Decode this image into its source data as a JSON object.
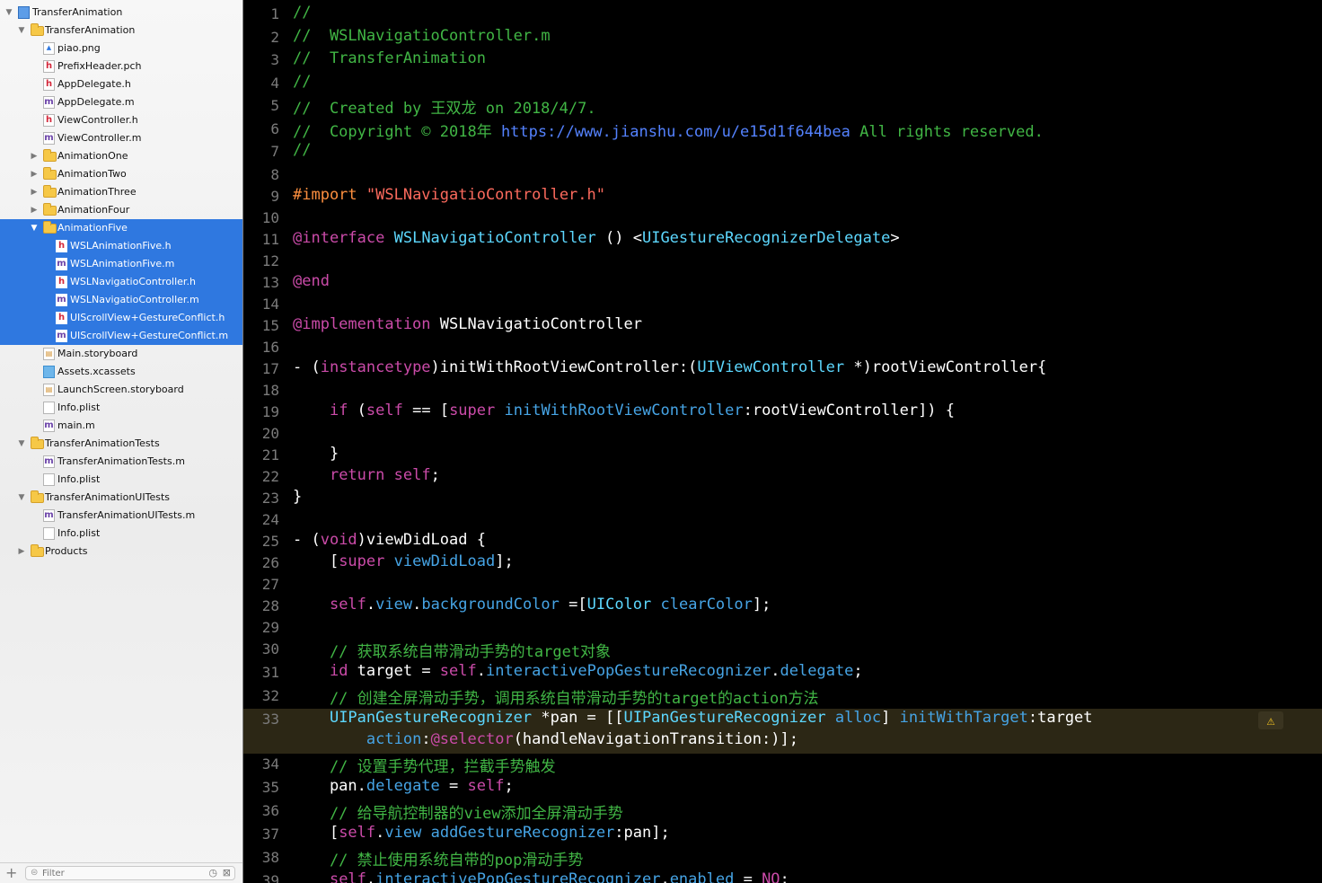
{
  "navigator": {
    "items": [
      {
        "label": "TransferAnimation",
        "icon": "project-icon",
        "depth": 0,
        "expand": "expanded",
        "selected": false
      },
      {
        "label": "TransferAnimation",
        "icon": "folder-icon",
        "depth": 1,
        "expand": "expanded",
        "selected": false
      },
      {
        "label": "piao.png",
        "icon": "image-file-icon",
        "depth": 2,
        "expand": "none",
        "selected": false
      },
      {
        "label": "PrefixHeader.pch",
        "icon": "header-file-icon",
        "depth": 2,
        "expand": "none",
        "selected": false
      },
      {
        "label": "AppDelegate.h",
        "icon": "header-file-icon",
        "depth": 2,
        "expand": "none",
        "selected": false
      },
      {
        "label": "AppDelegate.m",
        "icon": "objc-file-icon",
        "depth": 2,
        "expand": "none",
        "selected": false
      },
      {
        "label": "ViewController.h",
        "icon": "header-file-icon",
        "depth": 2,
        "expand": "none",
        "selected": false
      },
      {
        "label": "ViewController.m",
        "icon": "objc-file-icon",
        "depth": 2,
        "expand": "none",
        "selected": false
      },
      {
        "label": "AnimationOne",
        "icon": "folder-icon",
        "depth": 2,
        "expand": "collapsed",
        "selected": false
      },
      {
        "label": "AnimationTwo",
        "icon": "folder-icon",
        "depth": 2,
        "expand": "collapsed",
        "selected": false
      },
      {
        "label": "AnimationThree",
        "icon": "folder-icon",
        "depth": 2,
        "expand": "collapsed",
        "selected": false
      },
      {
        "label": "AnimationFour",
        "icon": "folder-icon",
        "depth": 2,
        "expand": "collapsed",
        "selected": false
      },
      {
        "label": "AnimationFive",
        "icon": "folder-icon",
        "depth": 2,
        "expand": "expanded",
        "selected": true
      },
      {
        "label": "WSLAnimationFive.h",
        "icon": "header-file-icon",
        "depth": 3,
        "expand": "none",
        "selected": true
      },
      {
        "label": "WSLAnimationFive.m",
        "icon": "objc-file-icon",
        "depth": 3,
        "expand": "none",
        "selected": true
      },
      {
        "label": "WSLNavigatioController.h",
        "icon": "header-file-icon",
        "depth": 3,
        "expand": "none",
        "selected": true
      },
      {
        "label": "WSLNavigatioController.m",
        "icon": "objc-file-icon",
        "depth": 3,
        "expand": "none",
        "selected": true
      },
      {
        "label": "UIScrollView+GestureConflict.h",
        "icon": "header-file-icon",
        "depth": 3,
        "expand": "none",
        "selected": true
      },
      {
        "label": "UIScrollView+GestureConflict.m",
        "icon": "objc-file-icon",
        "depth": 3,
        "expand": "none",
        "selected": true
      },
      {
        "label": "Main.storyboard",
        "icon": "storyboard-file-icon",
        "depth": 2,
        "expand": "none",
        "selected": false
      },
      {
        "label": "Assets.xcassets",
        "icon": "asset-catalog-icon",
        "depth": 2,
        "expand": "none",
        "selected": false
      },
      {
        "label": "LaunchScreen.storyboard",
        "icon": "storyboard-file-icon",
        "depth": 2,
        "expand": "none",
        "selected": false
      },
      {
        "label": "Info.plist",
        "icon": "plist-file-icon",
        "depth": 2,
        "expand": "none",
        "selected": false
      },
      {
        "label": "main.m",
        "icon": "objc-file-icon",
        "depth": 2,
        "expand": "none",
        "selected": false
      },
      {
        "label": "TransferAnimationTests",
        "icon": "folder-icon",
        "depth": 1,
        "expand": "expanded",
        "selected": false
      },
      {
        "label": "TransferAnimationTests.m",
        "icon": "objc-file-icon",
        "depth": 2,
        "expand": "none",
        "selected": false
      },
      {
        "label": "Info.plist",
        "icon": "plist-file-icon",
        "depth": 2,
        "expand": "none",
        "selected": false
      },
      {
        "label": "TransferAnimationUITests",
        "icon": "folder-icon",
        "depth": 1,
        "expand": "expanded",
        "selected": false
      },
      {
        "label": "TransferAnimationUITests.m",
        "icon": "objc-file-icon",
        "depth": 2,
        "expand": "none",
        "selected": false
      },
      {
        "label": "Info.plist",
        "icon": "plist-file-icon",
        "depth": 2,
        "expand": "none",
        "selected": false
      },
      {
        "label": "Products",
        "icon": "folder-icon",
        "depth": 1,
        "expand": "collapsed",
        "selected": false
      }
    ],
    "filter_placeholder": "Filter",
    "add_symbol": "+",
    "colors": {
      "selection": "#2f78e0",
      "background": "#f5f5f5"
    }
  },
  "editor": {
    "colors": {
      "background": "#000000",
      "comment": "#41b645",
      "keyword": "#cb4ba9",
      "string": "#fc6a5d",
      "preprocessor": "#fd8f3f",
      "type": "#5dd8ff",
      "method": "#46a4e5",
      "url": "#5482ff",
      "highlight_line": "#2c2715"
    },
    "warning_icon": "warning-icon",
    "lines": [
      {
        "n": "1",
        "tokens": [
          [
            "c",
            "//"
          ]
        ]
      },
      {
        "n": "2",
        "tokens": [
          [
            "c",
            "//  WSLNavigatioController.m"
          ]
        ]
      },
      {
        "n": "3",
        "tokens": [
          [
            "c",
            "//  TransferAnimation"
          ]
        ]
      },
      {
        "n": "4",
        "tokens": [
          [
            "c",
            "//"
          ]
        ]
      },
      {
        "n": "5",
        "tokens": [
          [
            "c",
            "//  Created by 王双龙 on 2018/4/7."
          ]
        ]
      },
      {
        "n": "6",
        "tokens": [
          [
            "c",
            "//  Copyright © 2018年 "
          ],
          [
            "u",
            "https://www.jianshu.com/u/e15d1f644bea"
          ],
          [
            "c",
            " All rights reserved."
          ]
        ]
      },
      {
        "n": "7",
        "tokens": [
          [
            "c",
            "//"
          ]
        ]
      },
      {
        "n": "8",
        "tokens": []
      },
      {
        "n": "9",
        "tokens": [
          [
            "p",
            "#import "
          ],
          [
            "s",
            "\"WSLNavigatioController.h\""
          ]
        ]
      },
      {
        "n": "10",
        "tokens": []
      },
      {
        "n": "11",
        "tokens": [
          [
            "k",
            "@interface"
          ],
          [
            "pl",
            " "
          ],
          [
            "t",
            "WSLNavigatioController"
          ],
          [
            "pl",
            " () <"
          ],
          [
            "t",
            "UIGestureRecognizerDelegate"
          ],
          [
            "pl",
            ">"
          ]
        ]
      },
      {
        "n": "12",
        "tokens": []
      },
      {
        "n": "13",
        "tokens": [
          [
            "k",
            "@end"
          ]
        ]
      },
      {
        "n": "14",
        "tokens": []
      },
      {
        "n": "15",
        "tokens": [
          [
            "k",
            "@implementation"
          ],
          [
            "pl",
            " WSLNavigatioController"
          ]
        ]
      },
      {
        "n": "16",
        "tokens": []
      },
      {
        "n": "17",
        "tokens": [
          [
            "pl",
            "- ("
          ],
          [
            "k",
            "instancetype"
          ],
          [
            "pl",
            ")initWithRootViewController:("
          ],
          [
            "t",
            "UIViewController"
          ],
          [
            "pl",
            " *)rootViewController{"
          ]
        ]
      },
      {
        "n": "18",
        "tokens": []
      },
      {
        "n": "19",
        "tokens": [
          [
            "pl",
            "    "
          ],
          [
            "k",
            "if"
          ],
          [
            "pl",
            " ("
          ],
          [
            "k",
            "self"
          ],
          [
            "pl",
            " == ["
          ],
          [
            "k",
            "super"
          ],
          [
            "pl",
            " "
          ],
          [
            "m",
            "initWithRootViewController"
          ],
          [
            "pl",
            ":rootViewController]) {"
          ]
        ]
      },
      {
        "n": "20",
        "tokens": []
      },
      {
        "n": "21",
        "tokens": [
          [
            "pl",
            "    }"
          ]
        ]
      },
      {
        "n": "22",
        "tokens": [
          [
            "pl",
            "    "
          ],
          [
            "k",
            "return"
          ],
          [
            "pl",
            " "
          ],
          [
            "k",
            "self"
          ],
          [
            "pl",
            ";"
          ]
        ]
      },
      {
        "n": "23",
        "tokens": [
          [
            "pl",
            "}"
          ]
        ]
      },
      {
        "n": "24",
        "tokens": []
      },
      {
        "n": "25",
        "tokens": [
          [
            "pl",
            "- ("
          ],
          [
            "k",
            "void"
          ],
          [
            "pl",
            ")viewDidLoad {"
          ]
        ]
      },
      {
        "n": "26",
        "tokens": [
          [
            "pl",
            "    ["
          ],
          [
            "k",
            "super"
          ],
          [
            "pl",
            " "
          ],
          [
            "m",
            "viewDidLoad"
          ],
          [
            "pl",
            "];"
          ]
        ]
      },
      {
        "n": "27",
        "tokens": []
      },
      {
        "n": "28",
        "tokens": [
          [
            "pl",
            "    "
          ],
          [
            "k",
            "self"
          ],
          [
            "pl",
            "."
          ],
          [
            "m",
            "view"
          ],
          [
            "pl",
            "."
          ],
          [
            "m",
            "backgroundColor"
          ],
          [
            "pl",
            " =["
          ],
          [
            "t",
            "UIColor"
          ],
          [
            "pl",
            " "
          ],
          [
            "m",
            "clearColor"
          ],
          [
            "pl",
            "];"
          ]
        ]
      },
      {
        "n": "29",
        "tokens": []
      },
      {
        "n": "30",
        "tokens": [
          [
            "c",
            "    // 获取系统自带滑动手势的target对象"
          ]
        ]
      },
      {
        "n": "31",
        "tokens": [
          [
            "pl",
            "    "
          ],
          [
            "k",
            "id"
          ],
          [
            "pl",
            " target = "
          ],
          [
            "k",
            "self"
          ],
          [
            "pl",
            "."
          ],
          [
            "m",
            "interactivePopGestureRecognizer"
          ],
          [
            "pl",
            "."
          ],
          [
            "m",
            "delegate"
          ],
          [
            "pl",
            ";"
          ]
        ]
      },
      {
        "n": "32",
        "tokens": [
          [
            "c",
            "    // 创建全屏滑动手势，调用系统自带滑动手势的target的action方法"
          ]
        ]
      },
      {
        "n": "33",
        "highlight": true,
        "tokens": [
          [
            "pl",
            "    "
          ],
          [
            "t",
            "UIPanGestureRecognizer"
          ],
          [
            "pl",
            " *pan = [["
          ],
          [
            "t",
            "UIPanGestureRecognizer"
          ],
          [
            "pl",
            " "
          ],
          [
            "m",
            "alloc"
          ],
          [
            "pl",
            "] "
          ],
          [
            "m",
            "initWithTarget"
          ],
          [
            "pl",
            ":target"
          ]
        ],
        "tokens2": [
          [
            "pl",
            "        "
          ],
          [
            "m",
            "action"
          ],
          [
            "pl",
            ":"
          ],
          [
            "k",
            "@selector"
          ],
          [
            "pl",
            "(handleNavigationTransition:)];"
          ]
        ]
      },
      {
        "n": "34",
        "tokens": [
          [
            "c",
            "    // 设置手势代理，拦截手势触发"
          ]
        ]
      },
      {
        "n": "35",
        "tokens": [
          [
            "pl",
            "    pan."
          ],
          [
            "m",
            "delegate"
          ],
          [
            "pl",
            " = "
          ],
          [
            "k",
            "self"
          ],
          [
            "pl",
            ";"
          ]
        ]
      },
      {
        "n": "36",
        "tokens": [
          [
            "c",
            "    // 给导航控制器的view添加全屏滑动手势"
          ]
        ]
      },
      {
        "n": "37",
        "tokens": [
          [
            "pl",
            "    ["
          ],
          [
            "k",
            "self"
          ],
          [
            "pl",
            "."
          ],
          [
            "m",
            "view"
          ],
          [
            "pl",
            " "
          ],
          [
            "m",
            "addGestureRecognizer"
          ],
          [
            "pl",
            ":pan];"
          ]
        ]
      },
      {
        "n": "38",
        "tokens": [
          [
            "c",
            "    // 禁止使用系统自带的pop滑动手势"
          ]
        ]
      },
      {
        "n": "39",
        "tokens": [
          [
            "pl",
            "    "
          ],
          [
            "k",
            "self"
          ],
          [
            "pl",
            "."
          ],
          [
            "m",
            "interactivePopGestureRecognizer"
          ],
          [
            "pl",
            "."
          ],
          [
            "m",
            "enabled"
          ],
          [
            "pl",
            " = "
          ],
          [
            "k",
            "NO"
          ],
          [
            "pl",
            ";"
          ]
        ]
      }
    ]
  }
}
